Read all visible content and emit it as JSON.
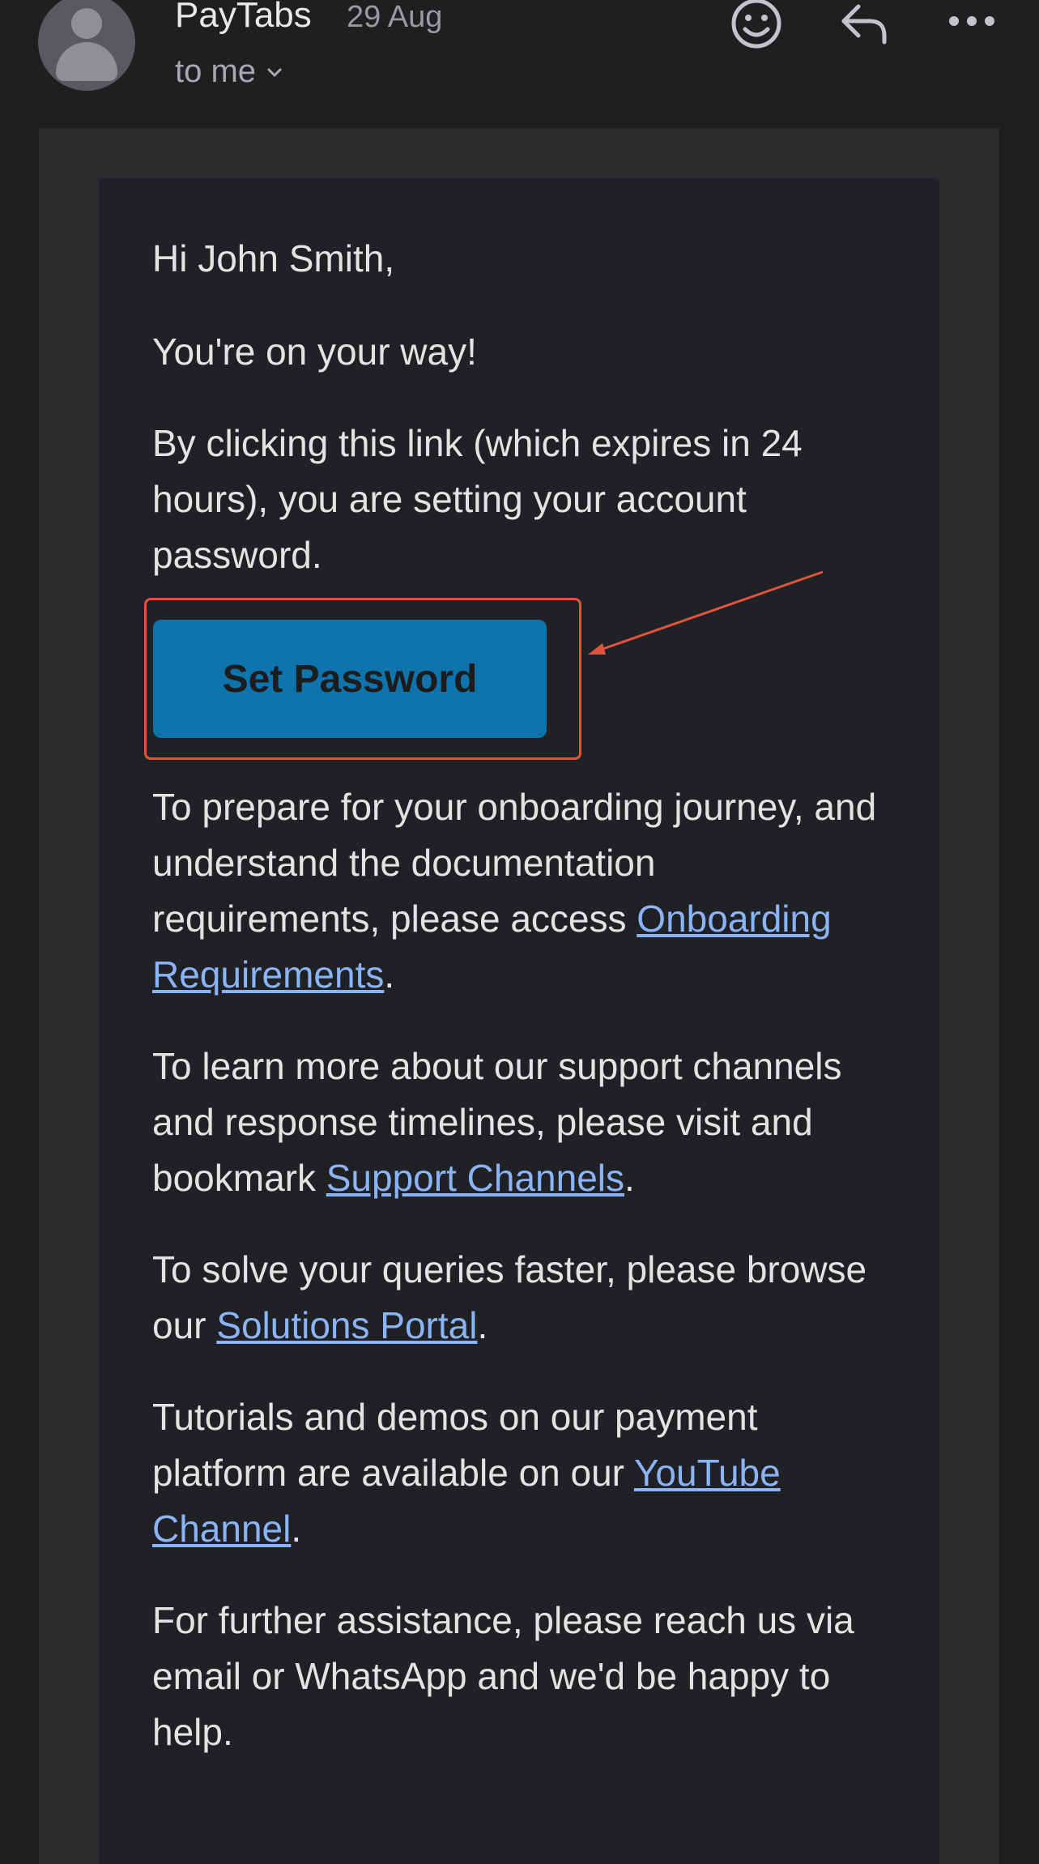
{
  "header": {
    "sender": "PayTabs",
    "date": "29 Aug",
    "recipient": "to me",
    "icons": [
      "emoji-icon",
      "reply-icon",
      "more-icon"
    ]
  },
  "email": {
    "greeting": "Hi John Smith,",
    "line1": "You're on your way!",
    "line2": "By clicking this link (which expires in 24 hours), you are setting your account password.",
    "button_label": "Set Password",
    "p3_text": "To prepare for your onboarding journey, and understand the documentation requirements, please access ",
    "p3_link": "Onboarding Requirements",
    "p4_text": "To learn more about our support channels and response timelines, please visit and bookmark ",
    "p4_link": "Support Channels",
    "p5_text": "To solve your queries faster, please browse our ",
    "p5_link": "Solutions Portal",
    "p6_text": "Tutorials and demos on our payment platform are available on our ",
    "p6_link": "YouTube Channel",
    "p7_text": "For further assistance, please reach us via email or WhatsApp and we'd be happy to help.",
    "period": "."
  },
  "colors": {
    "background": "#1f1f21",
    "button": "#0e74ab",
    "link": "#8ab4f8",
    "annotation": "#e0533d"
  }
}
